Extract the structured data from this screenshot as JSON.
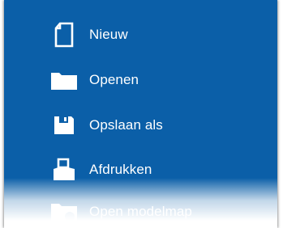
{
  "menu": {
    "items": [
      {
        "label": "Nieuw",
        "icon": "new-document-icon"
      },
      {
        "label": "Openen",
        "icon": "folder-icon"
      },
      {
        "label": "Opslaan als",
        "icon": "save-icon"
      },
      {
        "label": "Afdrukken",
        "icon": "printer-icon"
      },
      {
        "label": "Open modelmap",
        "icon": "folder-icon"
      }
    ]
  },
  "colors": {
    "panel_background": "#0b5fa8",
    "text": "#ffffff"
  }
}
